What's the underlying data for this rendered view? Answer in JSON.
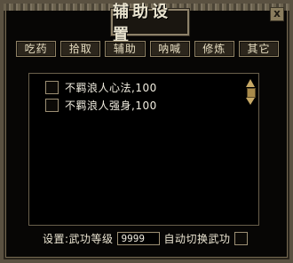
{
  "window": {
    "title": "辅助设置",
    "close_glyph": "x"
  },
  "tabs": [
    {
      "label": "吃药"
    },
    {
      "label": "拾取"
    },
    {
      "label": "辅助"
    },
    {
      "label": "呐喊"
    },
    {
      "label": "修炼"
    },
    {
      "label": "其它"
    }
  ],
  "skill_list": {
    "items": [
      {
        "label": "不羁浪人心法,100",
        "checked": false
      },
      {
        "label": "不羁浪人强身,100",
        "checked": false
      }
    ]
  },
  "settings": {
    "label": "设置:武功等级",
    "level_value": "9999",
    "auto_switch_label": "自动切换武功",
    "auto_switch_checked": false
  }
}
